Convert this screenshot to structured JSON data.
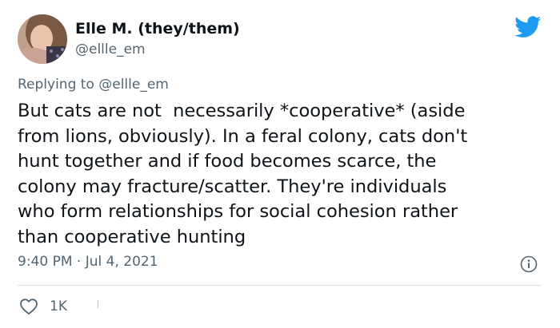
{
  "author": {
    "display_name": "Elle M. (they/them)",
    "handle": "@ellle_em"
  },
  "reply": {
    "prefix": "Replying to ",
    "mention": "@ellle_em"
  },
  "tweet": {
    "text": "But cats are not  necessarily *cooperative* (aside\nfrom lions, obviously). In a feral colony, cats don't\nhunt together and if food becomes scarce, the\ncolony may fracture/scatter. They're individuals\nwho form relationships for social cohesion rather\nthan cooperative hunting",
    "timestamp": "9:40 PM · Jul 4, 2021"
  },
  "actions": {
    "like_count": "1K"
  },
  "colors": {
    "brand": "#1d9bf0",
    "secondary_text": "#536471",
    "divider": "#dfe3e6"
  },
  "icons": {
    "brand": "twitter-bird-icon",
    "info": "info-icon",
    "like": "heart-icon"
  }
}
